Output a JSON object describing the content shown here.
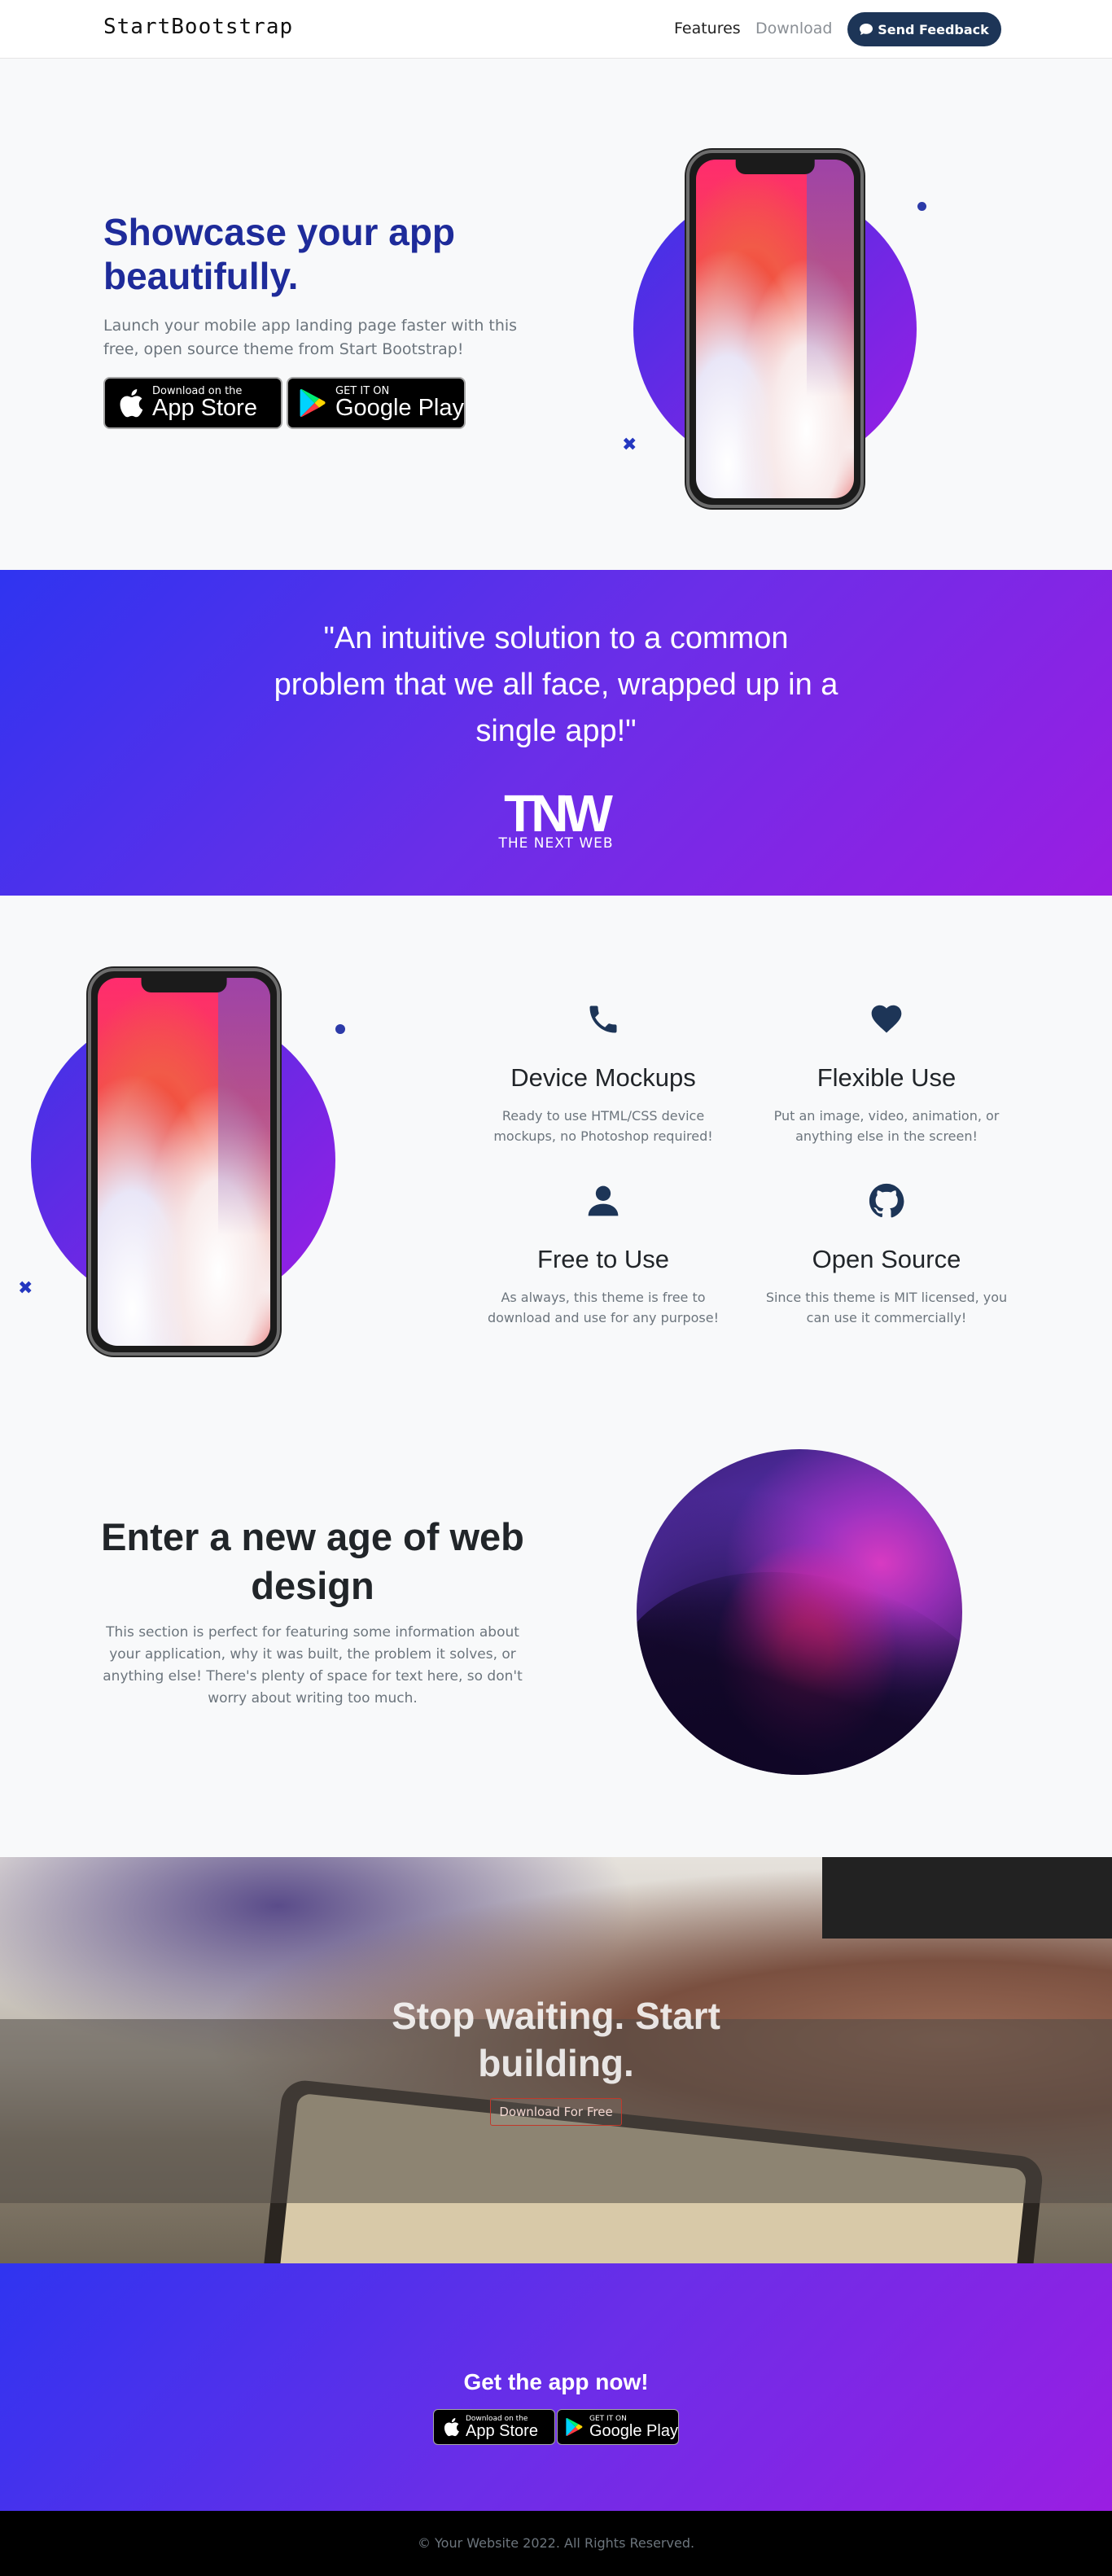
{
  "nav": {
    "brand": "StartBootstrap",
    "links": [
      "Features",
      "Download"
    ],
    "feedback_label": "Send Feedback"
  },
  "hero": {
    "title": "Showcase your app beautifully.",
    "subtitle": "Launch your mobile app landing page faster with this free, open source theme from Start Bootstrap!",
    "app_store": {
      "small": "Download on the",
      "big": "App Store"
    },
    "google_play": {
      "small": "GET IT ON",
      "big": "Google Play"
    }
  },
  "quote": {
    "text": "\"An intuitive solution to a common problem that we all face, wrapped up in a single app!\"",
    "logo_word": "TNW",
    "logo_caption": "THE NEXT WEB"
  },
  "features": [
    {
      "icon": "phone-icon",
      "title": "Device Mockups",
      "text": "Ready to use HTML/CSS device mockups, no Photoshop required!"
    },
    {
      "icon": "heart-icon",
      "title": "Flexible Use",
      "text": "Put an image, video, animation, or anything else in the screen!"
    },
    {
      "icon": "person-icon",
      "title": "Free to Use",
      "text": "As always, this theme is free to download and use for any purpose!"
    },
    {
      "icon": "github-icon",
      "title": "Open Source",
      "text": "Since this theme is MIT licensed, you can use it commercially!"
    }
  ],
  "webdesign": {
    "title": "Enter a new age of web design",
    "text": "This section is perfect for featuring some information about your application, why it was built, the problem it solves, or anything else! There's plenty of space for text here, so don't worry about writing too much."
  },
  "cta": {
    "title": "Stop waiting. Start building.",
    "button": "Download For Free"
  },
  "getapp": {
    "title": "Get the app now!",
    "app_store": {
      "small": "Download on the",
      "big": "App Store"
    },
    "google_play": {
      "small": "GET IT ON",
      "big": "Google Play"
    }
  },
  "footer": {
    "text": "© Your Website 2022. All Rights Reserved."
  },
  "colors": {
    "brand_blue": "#1e2b9a",
    "feedback_btn": "#1d3557",
    "gradient_start": "#2f34f0",
    "gradient_end": "#9a1ee2"
  }
}
